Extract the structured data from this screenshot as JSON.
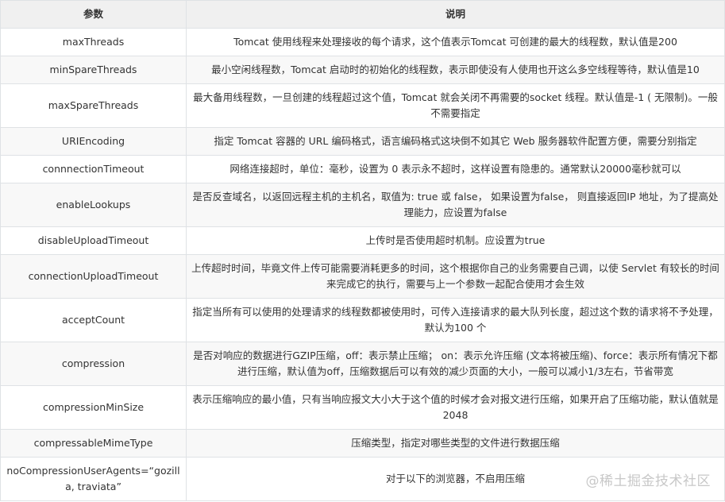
{
  "table": {
    "headers": [
      "参数",
      "说明"
    ],
    "rows": [
      {
        "param": "maxThreads",
        "desc": "Tomcat 使用线程来处理接收的每个请求，这个值表示Tomcat 可创建的最大的线程数，默认值是200"
      },
      {
        "param": "minSpareThreads",
        "desc": "最小空闲线程数，Tomcat 启动时的初始化的线程数，表示即使没有人使用也开这么多空线程等待，默认值是10"
      },
      {
        "param": "maxSpareThreads",
        "desc": "最大备用线程数，一旦创建的线程超过这个值，Tomcat 就会关闭不再需要的socket 线程。默认值是-1 ( 无限制)。一般不需要指定"
      },
      {
        "param": "URIEncoding",
        "desc": "指定 Tomcat 容器的 URL 编码格式，语言编码格式这块倒不如其它 Web 服务器软件配置方便，需要分别指定"
      },
      {
        "param": "connnectionTimeout",
        "desc": "网络连接超时，单位：毫秒，设置为 0 表示永不超时，这样设置有隐患的。通常默认20000毫秒就可以"
      },
      {
        "param": "enableLookups",
        "desc": "是否反查域名，以返回远程主机的主机名，取值为: true 或 false， 如果设置为false， 则直接返回IP 地址，为了提高处理能力，应设置为false"
      },
      {
        "param": "disableUploadTimeout",
        "desc": "上传时是否使用超时机制。应设置为true"
      },
      {
        "param": "connectionUploadTimeout",
        "desc": "上传超时时间，毕竟文件上传可能需要消耗更多的时间，这个根据你自己的业务需要自己调，以使 Servlet 有较长的时间来完成它的执行，需要与上一个参数一起配合使用才会生效"
      },
      {
        "param": "acceptCount",
        "desc": "指定当所有可以使用的处理请求的线程数都被使用时，可传入连接请求的最大队列长度，超过这个数的请求将不予处理，默认为100 个"
      },
      {
        "param": "compression",
        "desc": "是否对响应的数据进行GZIP压缩，off：表示禁止压缩； on：表示允许压缩 (文本将被压缩)、force：表示所有情况下都进行压缩，默认值为off，压缩数据后可以有效的减少页面的大小，一般可以减小1/3左右，节省带宽"
      },
      {
        "param": "compressionMinSize",
        "desc": "表示压缩响应的最小值，只有当响应报文大小大于这个值的时候才会对报文进行压缩，如果开启了压缩功能，默认值就是2048"
      },
      {
        "param": "compressableMimeType",
        "desc": "压缩类型，指定对哪些类型的文件进行数据压缩"
      },
      {
        "param": "noCompressionUserAgents=“gozilla, traviata”",
        "desc": "对于以下的浏览器，不启用压缩"
      }
    ]
  },
  "watermark": "@稀土掘金技术社区",
  "colors": {
    "header_bg": "#f0f0f0",
    "alt_row_bg": "#f8f8f8",
    "border": "#dfe2e5",
    "text": "#333333"
  }
}
